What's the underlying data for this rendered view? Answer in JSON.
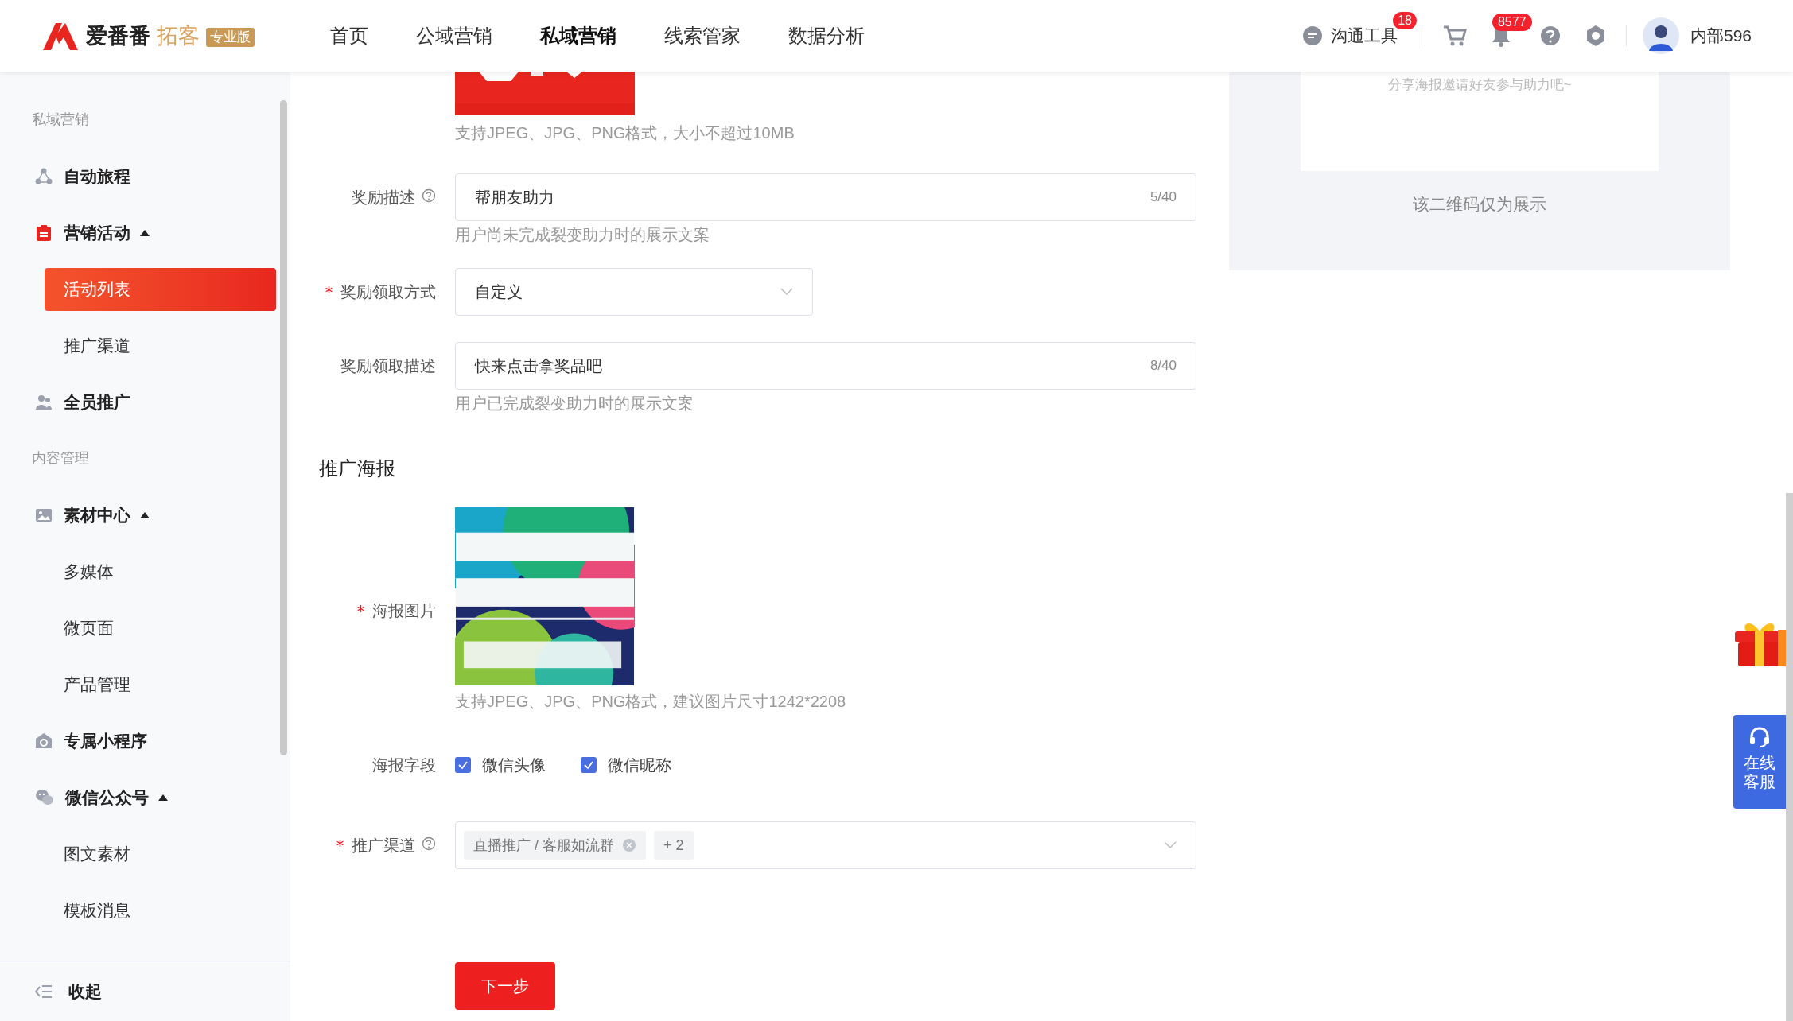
{
  "header": {
    "logo": {
      "name": "爱番番",
      "product": "拓客",
      "edition": "专业版"
    },
    "nav": [
      {
        "label": "首页",
        "selected": false
      },
      {
        "label": "公域营销",
        "selected": false
      },
      {
        "label": "私域营销",
        "selected": true
      },
      {
        "label": "线索管家",
        "selected": false
      },
      {
        "label": "数据分析",
        "selected": false
      }
    ],
    "chat_label": "沟通工具",
    "chat_badge": "18",
    "notice_badge": "8577",
    "user": "内部596"
  },
  "sidebar": {
    "items": [
      {
        "kind": "heading",
        "label": "私域营销"
      },
      {
        "kind": "group",
        "label": "自动旅程"
      },
      {
        "kind": "folder",
        "label": "营销活动",
        "expanded": true
      },
      {
        "kind": "child",
        "label": "活动列表",
        "selected": true
      },
      {
        "kind": "child",
        "label": "推广渠道",
        "selected": false
      },
      {
        "kind": "group",
        "label": "全员推广"
      },
      {
        "kind": "heading",
        "label": "内容管理"
      },
      {
        "kind": "folder",
        "label": "素材中心",
        "expanded": true
      },
      {
        "kind": "child",
        "label": "多媒体",
        "selected": false
      },
      {
        "kind": "child",
        "label": "微页面",
        "selected": false
      },
      {
        "kind": "child",
        "label": "产品管理",
        "selected": false
      },
      {
        "kind": "group",
        "label": "专属小程序"
      },
      {
        "kind": "folder",
        "label": "微信公众号",
        "expanded": true
      },
      {
        "kind": "child",
        "label": "图文素材",
        "selected": false
      },
      {
        "kind": "child",
        "label": "模板消息",
        "selected": false
      }
    ],
    "collapse": "收起"
  },
  "form": {
    "rows": [
      {
        "kind": "upload-tail",
        "hint": "支持JPEG、JPG、PNG格式，大小不超过10MB"
      },
      {
        "kind": "input",
        "label": "奖励描述",
        "required": false,
        "help": true,
        "value": "帮朋友助力",
        "count": "5/40",
        "hint": "用户尚未完成裂变助力时的展示文案"
      },
      {
        "kind": "select",
        "label": "奖励领取方式",
        "required": true,
        "help": false,
        "value": "自定义"
      },
      {
        "kind": "input",
        "label": "奖励领取描述",
        "required": false,
        "help": false,
        "value": "快来点击拿奖品吧",
        "count": "8/40",
        "hint": "用户已完成裂变助力时的展示文案"
      },
      {
        "kind": "section",
        "label": "推广海报"
      },
      {
        "kind": "upload",
        "label": "海报图片",
        "required": true,
        "help": false,
        "hint": "支持JPEG、JPG、PNG格式，建议图片尺寸1242*2208"
      },
      {
        "kind": "checkboxes",
        "label": "海报字段",
        "required": false,
        "help": false,
        "options": [
          {
            "label": "微信头像",
            "checked": true
          },
          {
            "label": "微信昵称",
            "checked": true
          }
        ]
      },
      {
        "kind": "tags",
        "label": "推广渠道",
        "required": true,
        "help": true,
        "tags": [
          "直播推广 / 客服如流群"
        ],
        "more": "+ 2"
      },
      {
        "kind": "button",
        "label": "下一步"
      }
    ]
  },
  "preview": {
    "caption": "分享海报邀请好友参与助力吧~",
    "note": "该二维码仅为展示"
  },
  "service": "在线客服"
}
